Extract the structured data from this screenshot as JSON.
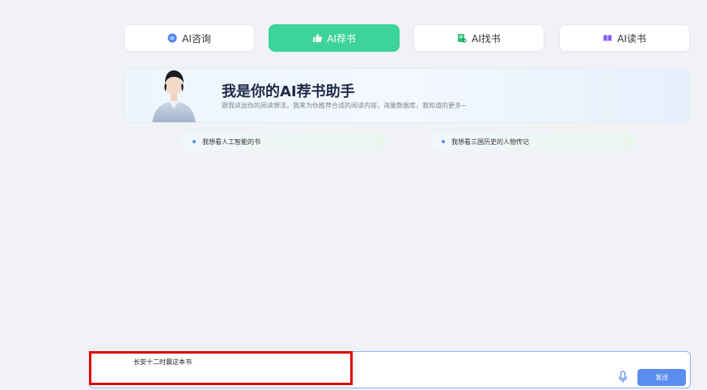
{
  "tabs": [
    {
      "label": "AI咨询",
      "icon": "chat-bubble-icon",
      "active": false
    },
    {
      "label": "AI荐书",
      "icon": "thumbs-up-icon",
      "active": true
    },
    {
      "label": "AI找书",
      "icon": "book-search-icon",
      "active": false
    },
    {
      "label": "AI读书",
      "icon": "open-book-icon",
      "active": false
    }
  ],
  "banner": {
    "title": "我是你的AI荐书助手",
    "subtitle": "跟我说出你的阅读想法，我来为你推荐合适的阅读内容，海量数据库，我知道的更多~"
  },
  "suggestions": [
    {
      "label": "我想看人工智能的书"
    },
    {
      "label": "我想看三国历史的人物传记"
    }
  ],
  "input": {
    "value": "长安十二时晨这本书",
    "send_label": "发送"
  },
  "colors": {
    "accent": "#3dd39b",
    "send": "#5b8def",
    "highlight": "#e00000"
  }
}
